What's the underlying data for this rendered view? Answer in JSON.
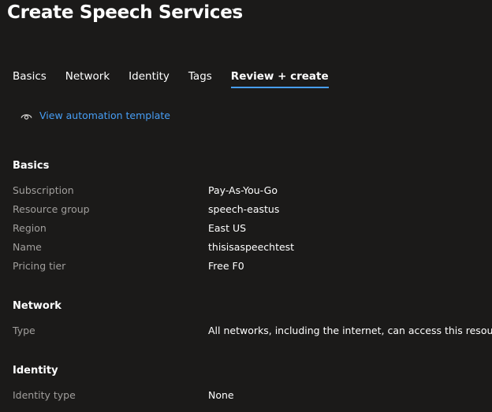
{
  "header": {
    "title": "Create Speech Services",
    "more_label": "···"
  },
  "tabs": [
    {
      "label": "Basics"
    },
    {
      "label": "Network"
    },
    {
      "label": "Identity"
    },
    {
      "label": "Tags"
    },
    {
      "label": "Review + create"
    }
  ],
  "automation": {
    "icon": "eye-icon",
    "label": "View automation template"
  },
  "sections": {
    "basics": {
      "heading": "Basics",
      "rows": [
        {
          "label": "Subscription",
          "value": "Pay-As-You-Go"
        },
        {
          "label": "Resource group",
          "value": "speech-eastus"
        },
        {
          "label": "Region",
          "value": "East US"
        },
        {
          "label": "Name",
          "value": "thisisaspeechtest"
        },
        {
          "label": "Pricing tier",
          "value": "Free F0"
        }
      ]
    },
    "network": {
      "heading": "Network",
      "rows": [
        {
          "label": "Type",
          "value": "All networks, including the internet, can access this resource."
        }
      ]
    },
    "identity": {
      "heading": "Identity",
      "rows": [
        {
          "label": "Identity type",
          "value": "None"
        }
      ]
    }
  },
  "colors": {
    "background": "#1b1a19",
    "accent": "#479ef5",
    "label_text": "#a19f9d",
    "value_text": "#ffffff"
  }
}
